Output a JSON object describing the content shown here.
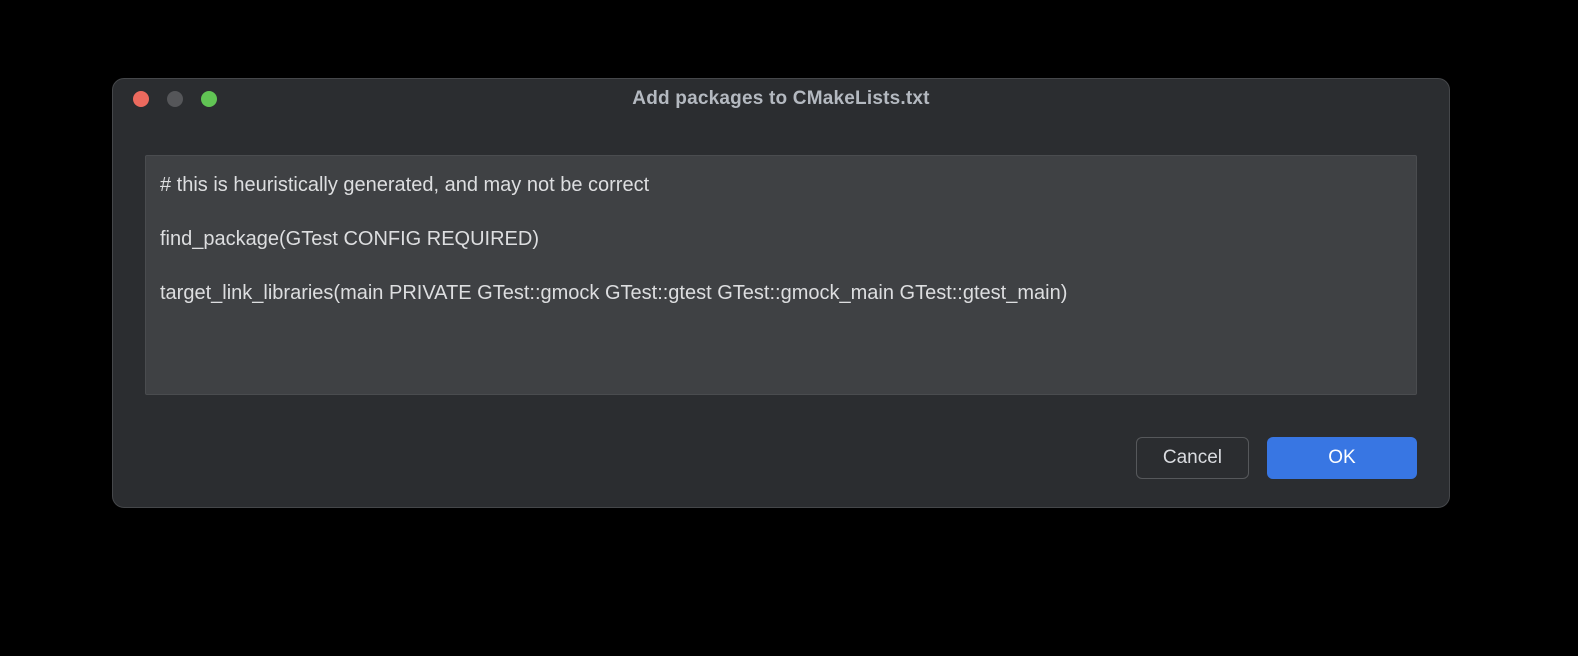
{
  "dialog": {
    "title": "Add packages to CMakeLists.txt",
    "code": {
      "line1": "# this is heuristically generated, and may not be correct",
      "line2": "find_package(GTest CONFIG REQUIRED)",
      "line3": "target_link_libraries(main PRIVATE GTest::gmock GTest::gtest GTest::gmock_main GTest::gtest_main)"
    },
    "buttons": {
      "cancel": "Cancel",
      "ok": "OK"
    }
  }
}
